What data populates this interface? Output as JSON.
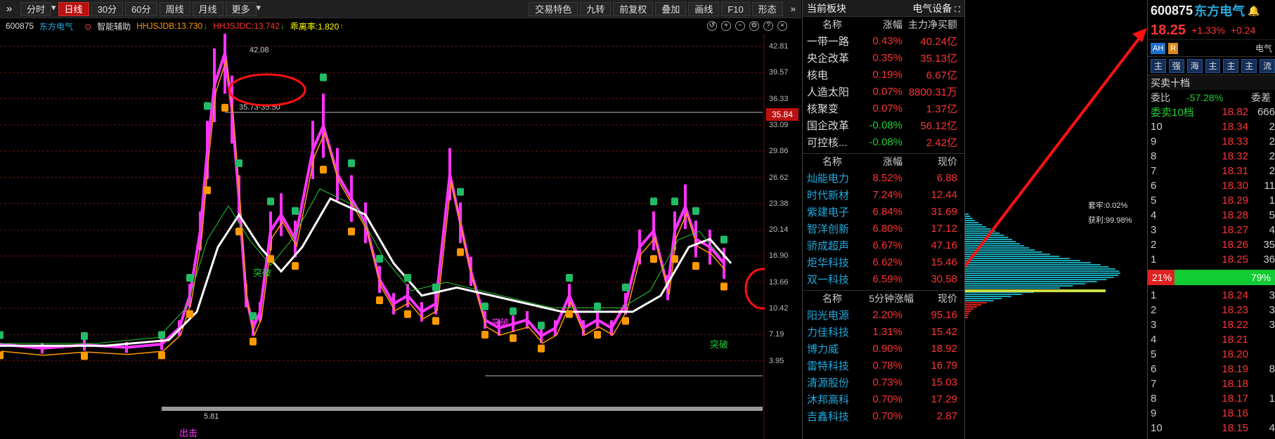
{
  "toolbar": {
    "left": [
      {
        "label": "分时"
      },
      {
        "label": "日线",
        "active": true
      },
      {
        "label": "30分"
      },
      {
        "label": "60分"
      },
      {
        "label": "周线"
      },
      {
        "label": "月线"
      },
      {
        "label": "更多"
      }
    ],
    "right": [
      "交易特色",
      "九转",
      "前复权",
      "叠加",
      "画线",
      "F10",
      "形态"
    ]
  },
  "indicator_bar": {
    "code": "600875",
    "name": "东方电气",
    "assist": "智能辅助",
    "ind1": "HHJSJDB:13.730",
    "ind2": "HHJSJDC:13.742",
    "ind3": "乖离率:1.820"
  },
  "chart": {
    "price_axis": [
      "42.81",
      "39.57",
      "36.33",
      "33.09",
      "29.86",
      "26.62",
      "23.38",
      "20.14",
      "16.90",
      "13.66",
      "10.42",
      "7.19",
      "3.95"
    ],
    "current_price_tag": "35.84",
    "peak_label": "42.08",
    "range_label": "35.73-35.50",
    "low_label": "5.81",
    "annotations": [
      "突破",
      "突破",
      "突破",
      "出击"
    ],
    "chip_stats": {
      "trap": "套牢:0.02%",
      "profit": "获利:99.98%"
    },
    "accent": "#ff2222"
  },
  "sector_panel": {
    "header": "当前板块",
    "industry": "电气设备",
    "columns": [
      "名称",
      "涨幅",
      "主力净买额"
    ],
    "rows": [
      {
        "name": "一带一路",
        "chg": "0.43%",
        "amt": "40.24亿",
        "up": true
      },
      {
        "name": "央企改革",
        "chg": "0.35%",
        "amt": "35.13亿",
        "up": true
      },
      {
        "name": "核电",
        "chg": "0.19%",
        "amt": "6.67亿",
        "up": true
      },
      {
        "name": "人造太阳",
        "chg": "0.07%",
        "amt": "8800.31万",
        "up": true
      },
      {
        "name": "核聚变",
        "chg": "0.07%",
        "amt": "1.37亿",
        "up": true
      },
      {
        "name": "国企改革",
        "chg": "-0.08%",
        "amt": "56.12亿",
        "up": false
      },
      {
        "name": "可控核...",
        "chg": "-0.08%",
        "amt": "2.42亿",
        "up": false
      }
    ]
  },
  "gainers_panel": {
    "columns": [
      "名称",
      "涨幅",
      "现价"
    ],
    "rows": [
      {
        "name": "灿能电力",
        "chg": "8.52%",
        "price": "6.88"
      },
      {
        "name": "时代新材",
        "chg": "7.24%",
        "price": "12.44"
      },
      {
        "name": "紫建电子",
        "chg": "6.84%",
        "price": "31.69"
      },
      {
        "name": "智洋创新",
        "chg": "6.80%",
        "price": "17.12"
      },
      {
        "name": "骄成超声",
        "chg": "6.67%",
        "price": "47.16"
      },
      {
        "name": "炬华科技",
        "chg": "6.62%",
        "price": "15.46"
      },
      {
        "name": "双一科技",
        "chg": "6.59%",
        "price": "30.58"
      }
    ]
  },
  "fivemin_panel": {
    "columns": [
      "名称",
      "5分钟涨幅",
      "现价"
    ],
    "rows": [
      {
        "name": "阳光电源",
        "chg": "2.20%",
        "price": "95.16"
      },
      {
        "name": "力佳科技",
        "chg": "1.31%",
        "price": "15.42"
      },
      {
        "name": "博力威",
        "chg": "0.90%",
        "price": "18.92"
      },
      {
        "name": "雷特科技",
        "chg": "0.78%",
        "price": "16.79"
      },
      {
        "name": "清源股份",
        "chg": "0.73%",
        "price": "15.03"
      },
      {
        "name": "沐邦高科",
        "chg": "0.70%",
        "price": "17.29"
      },
      {
        "name": "吉鑫科技",
        "chg": "0.70%",
        "price": "2.87"
      }
    ]
  },
  "quote": {
    "code": "600875",
    "name": "东方电气",
    "price": "18.25",
    "pct": "+1.33%",
    "chg": "+0.24",
    "badges": [
      "AH",
      "R"
    ],
    "extra": "电气",
    "buttons": [
      "主",
      "强",
      "海",
      "主",
      "主",
      "主",
      "流"
    ],
    "orderbook_title": "买卖十档",
    "weibi_label": "委比",
    "weibi": "-57.28%",
    "weicha_label": "委差",
    "sell_header": "委卖10档",
    "sell_header_price": "18.82",
    "sell_header_vol": "666",
    "sells": [
      {
        "n": "10",
        "p": "18.34",
        "v": "2"
      },
      {
        "n": "9",
        "p": "18.33",
        "v": "2"
      },
      {
        "n": "8",
        "p": "18.32",
        "v": "2"
      },
      {
        "n": "7",
        "p": "18.31",
        "v": "2"
      },
      {
        "n": "6",
        "p": "18.30",
        "v": "11"
      },
      {
        "n": "5",
        "p": "18.29",
        "v": "1"
      },
      {
        "n": "4",
        "p": "18.28",
        "v": "5"
      },
      {
        "n": "3",
        "p": "18.27",
        "v": "4"
      },
      {
        "n": "2",
        "p": "18.26",
        "v": "35"
      },
      {
        "n": "1",
        "p": "18.25",
        "v": "36"
      }
    ],
    "ratio_buy": "21%",
    "ratio_sell": "79%",
    "buys": [
      {
        "n": "1",
        "p": "18.24",
        "v": "3"
      },
      {
        "n": "2",
        "p": "18.23",
        "v": "3"
      },
      {
        "n": "3",
        "p": "18.22",
        "v": "3"
      },
      {
        "n": "4",
        "p": "18.21",
        "v": ""
      },
      {
        "n": "5",
        "p": "18.20",
        "v": ""
      },
      {
        "n": "6",
        "p": "18.19",
        "v": "8"
      },
      {
        "n": "7",
        "p": "18.18",
        "v": ""
      },
      {
        "n": "8",
        "p": "18.17",
        "v": "1"
      },
      {
        "n": "9",
        "p": "18.16",
        "v": ""
      },
      {
        "n": "10",
        "p": "18.15",
        "v": "4"
      }
    ]
  }
}
